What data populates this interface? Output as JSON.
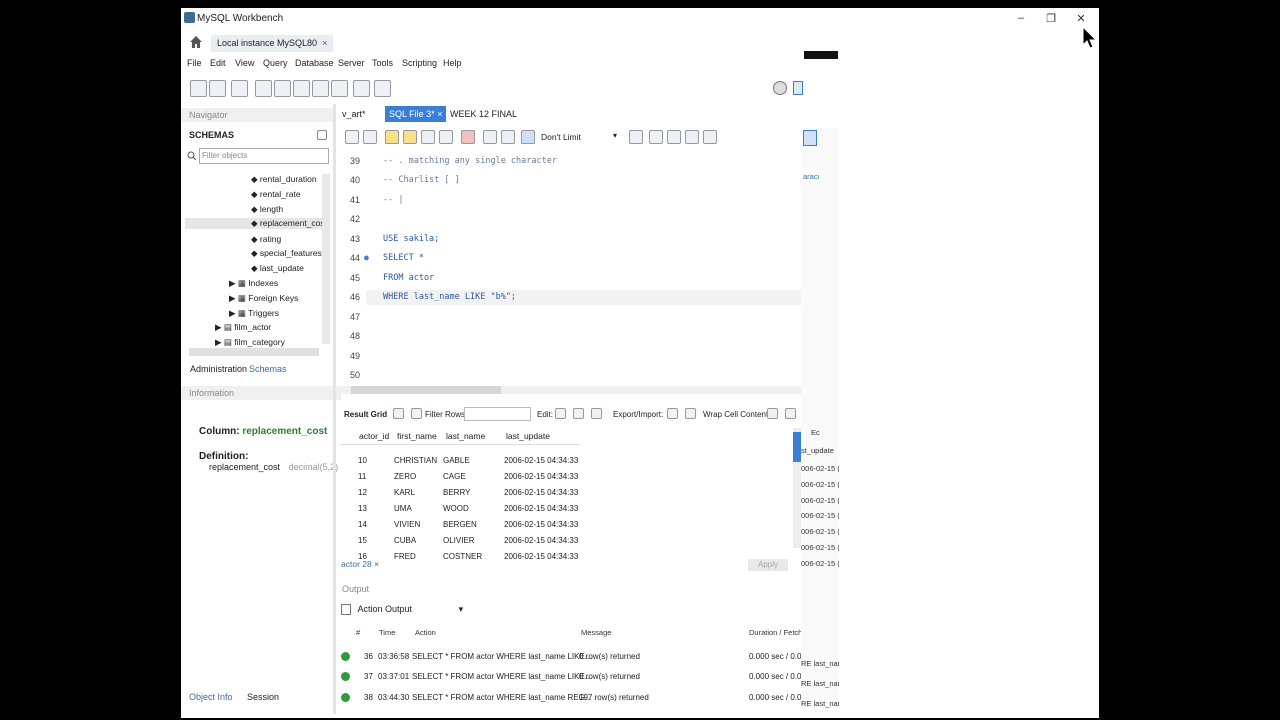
{
  "window": {
    "title": "MySQL Workbench",
    "min_icon": "–",
    "restore_icon": "❐",
    "close_icon": "✕"
  },
  "connection_tab": {
    "label": "Local instance MySQL80",
    "close": "×"
  },
  "menu": [
    "File",
    "Edit",
    "View",
    "Query",
    "Database",
    "Server",
    "Tools",
    "Scripting",
    "Help"
  ],
  "navigator": {
    "header": "Navigator",
    "schemas_label": "SCHEMAS",
    "filter_placeholder": "Filter objects",
    "columns": [
      "rental_duration",
      "rental_rate",
      "length",
      "replacement_cos",
      "rating",
      "special_features",
      "last_update"
    ],
    "groups": [
      "Indexes",
      "Foreign Keys",
      "Triggers"
    ],
    "tables": [
      "film_actor",
      "film_category"
    ],
    "tabs": [
      "Administration",
      "Schemas"
    ]
  },
  "information": {
    "header": "Information",
    "column_label": "Column:",
    "column_name": "replacement_cost",
    "definition_label": "Definition:",
    "def_name": "replacement_cost",
    "def_type": "decimal(5,2)"
  },
  "bottom_tabs": [
    "Object Info",
    "Session"
  ],
  "editor_tabs": [
    {
      "label": "v_art*",
      "active": false
    },
    {
      "label": "SQL File 3*",
      "active": true,
      "close": "×"
    },
    {
      "label": "WEEK 12 FINAL",
      "active": false
    }
  ],
  "sql_toolbar": {
    "limit_label": "Don't Limit"
  },
  "editor_lines": [
    {
      "num": "39",
      "text": "-- . matching any single character",
      "kind": "cm"
    },
    {
      "num": "40",
      "text": "-- Charlist [ ]",
      "kind": "cm"
    },
    {
      "num": "41",
      "text": "-- |",
      "kind": "cm"
    },
    {
      "num": "42",
      "text": "",
      "kind": ""
    },
    {
      "num": "43",
      "text": "USE sakila;",
      "kind": "sql"
    },
    {
      "num": "44",
      "text": "SELECT *",
      "kind": "sql"
    },
    {
      "num": "45",
      "text": "FROM actor",
      "kind": "sql"
    },
    {
      "num": "46",
      "text": "WHERE last_name LIKE \"b%\";",
      "kind": "sql"
    },
    {
      "num": "47",
      "text": "",
      "kind": ""
    },
    {
      "num": "48",
      "text": "",
      "kind": ""
    },
    {
      "num": "49",
      "text": "",
      "kind": ""
    },
    {
      "num": "50",
      "text": "",
      "kind": ""
    }
  ],
  "result_toolbar": {
    "result_grid": "Result Grid",
    "filter_rows": "Filter Rows:",
    "edit": "Edit:",
    "export_import": "Export/Import:",
    "wrap": "Wrap Cell Content:"
  },
  "result_columns": [
    "actor_id",
    "first_name",
    "last_name",
    "last_update"
  ],
  "result_rows": [
    [
      "10",
      "CHRISTIAN",
      "GABLE",
      "2006-02-15 04:34:33"
    ],
    [
      "11",
      "ZERO",
      "CAGE",
      "2006-02-15 04:34:33"
    ],
    [
      "12",
      "KARL",
      "BERRY",
      "2006-02-15 04:34:33"
    ],
    [
      "13",
      "UMA",
      "WOOD",
      "2006-02-15 04:34:33"
    ],
    [
      "14",
      "VIVIEN",
      "BERGEN",
      "2006-02-15 04:34:33"
    ],
    [
      "15",
      "CUBA",
      "OLIVIER",
      "2006-02-15 04:34:33"
    ],
    [
      "16",
      "FRED",
      "COSTNER",
      "2006-02-15 04:34:33"
    ]
  ],
  "result_tab": {
    "label": "actor 28",
    "close": "×"
  },
  "apply_label": "Apply",
  "output": {
    "header": "Output",
    "selector": "Action Output",
    "columns": [
      "#",
      "Time",
      "Action",
      "Message",
      "Duration / Fetch"
    ],
    "rows": [
      {
        "num": "36",
        "time": "03:36:58",
        "action": "SELECT * FROM actor WHERE last_name LIKE...",
        "message": "0 row(s) returned",
        "duration": "0.000 sec / 0.00..."
      },
      {
        "num": "37",
        "time": "03:37:01",
        "action": "SELECT * FROM actor WHERE last_name LIKE...",
        "message": "0 row(s) returned",
        "duration": "0.000 sec / 0.00..."
      },
      {
        "num": "38",
        "time": "03:44:30",
        "action": "SELECT * FROM actor WHERE last_name REG...",
        "message": "197 row(s) returned",
        "duration": "0.000 sec / 0.00..."
      }
    ]
  },
  "ghost_right": {
    "labels": [
      "aracı",
      "st_update",
      "006-02-15 (",
      "006-02-15 (",
      "006-02-15 (",
      "006-02-15 (",
      "006-02-15 (",
      "006-02-15 (",
      "006-02-15 (",
      "RE last_nar",
      "RE last_nar",
      "RE last_nar",
      "Ec"
    ]
  },
  "colors": {
    "accent": "#3a7fd5",
    "ok": "#2e9b3a",
    "chrome": "#f0f0f0"
  }
}
